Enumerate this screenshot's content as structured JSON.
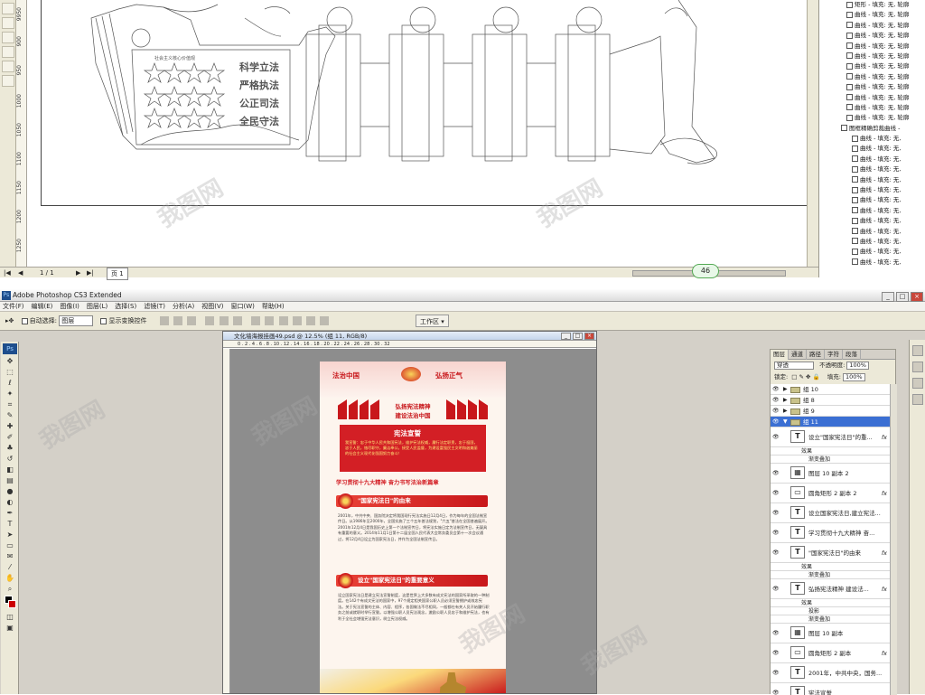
{
  "corel": {
    "vruler_labels": [
      "9950",
      "900",
      "950",
      "1000",
      "1050",
      "1100",
      "1150",
      "1200",
      "1250"
    ],
    "panel_rows": [
      {
        "icon": "rect",
        "text": "矩形 - 填充: 无, 轮廓"
      },
      {
        "icon": "curve",
        "text": "曲线 - 填充: 无, 轮廓"
      },
      {
        "icon": "curve",
        "text": "曲线 - 填充: 无, 轮廓"
      },
      {
        "icon": "curve",
        "text": "曲线 - 填充: 无, 轮廓"
      },
      {
        "icon": "curve",
        "text": "曲线 - 填充: 无, 轮廓"
      },
      {
        "icon": "curve",
        "text": "曲线 - 填充: 无, 轮廓"
      },
      {
        "icon": "curve",
        "text": "曲线 - 填充: 无, 轮廓"
      },
      {
        "icon": "curve",
        "text": "曲线 - 填充: 无, 轮廓"
      },
      {
        "icon": "curve",
        "text": "曲线 - 填充: 无, 轮廓"
      },
      {
        "icon": "curve",
        "text": "曲线 - 填充: 无, 轮廓"
      },
      {
        "icon": "curve",
        "text": "曲线 - 填充: 无, 轮廓"
      },
      {
        "icon": "curve",
        "text": "曲线 - 填充: 无, 轮廓"
      },
      {
        "icon": "group",
        "text": "图框精确剪裁曲线 - "
      },
      {
        "icon": "curve",
        "text": "曲线 - 填充: 无,"
      },
      {
        "icon": "curve",
        "text": "曲线 - 填充: 无,"
      },
      {
        "icon": "curve",
        "text": "曲线 - 填充: 无,"
      },
      {
        "icon": "curve",
        "text": "曲线 - 填充: 无,"
      },
      {
        "icon": "curve",
        "text": "曲线 - 填充: 无,"
      },
      {
        "icon": "curve",
        "text": "曲线 - 填充: 无,"
      },
      {
        "icon": "curve",
        "text": "曲线 - 填充: 无,"
      },
      {
        "icon": "curve",
        "text": "曲线 - 填充: 无,"
      },
      {
        "icon": "curve",
        "text": "曲线 - 填充: 无,"
      },
      {
        "icon": "curve",
        "text": "曲线 - 填充: 无,"
      },
      {
        "icon": "curve",
        "text": "曲线 - 填充: 无,"
      },
      {
        "icon": "curve",
        "text": "曲线 - 填充: 无,"
      },
      {
        "icon": "curve",
        "text": "曲线 - 填充: 无,"
      }
    ],
    "design_texts": {
      "slogan1": "科学立法",
      "slogan2": "严格执法",
      "slogan3": "公正司法",
      "slogan4": "全民守法",
      "header": "社会主义核心价值观"
    },
    "status": {
      "page_info": "1 / 1",
      "page_tab": "页 1",
      "zoom": "46"
    }
  },
  "ps": {
    "app_title": "Adobe Photoshop CS3 Extended",
    "menu": [
      "文件(F)",
      "编辑(E)",
      "图像(I)",
      "图层(L)",
      "选择(S)",
      "滤镜(T)",
      "分析(A)",
      "视图(V)",
      "窗口(W)",
      "帮助(H)"
    ],
    "options": {
      "auto_select_label": "自动选择:",
      "auto_select_value": "图层",
      "show_transform": "显示变换控件",
      "workspace": "工作区"
    },
    "doc": {
      "title": "文化墙海报挂画49.psd @ 12.5% (组 11, RGB/8)",
      "ruler": "0 . 2 . 4 . 6 . 8 . 10 . 12 . 14 . 16 . 18 . 20 . 22 . 24 . 26 . 28 . 30 . 32"
    },
    "poster": {
      "slogan_left": "法治中国",
      "slogan_right": "弘扬正气",
      "mid_line1": "弘扬宪法精神",
      "mid_line2": "建设法治中国",
      "band_title": "宪法宣誓",
      "band_body": "我宣誓：忠于中华人民共和国宪法，维护宪法权威，履行法定职责，忠于祖国，忠于人民，恪尽职守，廉洁奉公，接受人民监督，为建设富强民主文明和谐美丽的社会主义现代化强国努力奋斗！",
      "motto": "学习贯彻十九大精神  奋力书写法治新篇章",
      "sec1": "\"国家宪法日\"的由来",
      "para1": "2001年，中共中央、国务院决定将我国现行宪法实施日12月4日，作为每年的全国法制宣传日。从1986年至2000年，全国实施了三个五年普法规划，\"六五\"普法在全国普遍展开。2001年12月4日是我国历史上第一个法制宣传日，将宪法实施日定为法制宣传日，无疑具有重要的意义。2014年11月1日第十二届全国人民代表大会常务委员会第十一次会议通过，将12月4日设立为国家宪法日，并作为全国法制宣传日。",
      "sec2": "设立\"国家宪法日\"的重要意义",
      "para2": "设立国家宪法日是建立宪法宣誓制度，这是世界上大多数有成文宪法的国家所采取的一种制度。在142个有成文宪法的国家中，97个规定相关国家公职人员必须宣誓拥护或效忠宪法。关于宪法宣誓的主体、内容、程序，各国做法不尽相同，一般都在有关人员开始履行职务之前或就职时举行宣誓。以增强公职人员宪法观念，激励公职人员忠于和维护宪法，也有利于全社会增强宪法意识，树立宪法权威。"
    },
    "panel_tabs": [
      "图层",
      "通道",
      "路径",
      "字符",
      "段落"
    ],
    "blend_mode": "穿透",
    "opacity_label": "不透明度:",
    "opacity_value": "100%",
    "lock_label": "锁定:",
    "fill_label": "填充:",
    "fill_value": "100%",
    "layers": [
      {
        "type": "group",
        "name": "组 10",
        "selected": false
      },
      {
        "type": "group",
        "name": "组 8",
        "selected": false
      },
      {
        "type": "group",
        "name": "组 9",
        "selected": false
      },
      {
        "type": "group-open",
        "name": "组 11",
        "selected": true
      },
      {
        "type": "text",
        "name": "设立\"国家宪法日\"的重...",
        "fx": true
      },
      {
        "type": "sub",
        "name": "效果"
      },
      {
        "type": "sub2",
        "name": "渐变叠加"
      },
      {
        "type": "image",
        "name": "图层 10 副本 2"
      },
      {
        "type": "shape",
        "name": "圆角矩形 2 副本 2",
        "fx": true
      },
      {
        "type": "text",
        "name": "设立国家宪法日,建立宪法..."
      },
      {
        "type": "text",
        "name": "学习贯彻十九大精神 奋..."
      },
      {
        "type": "text",
        "name": "\"国家宪法日\"的由来",
        "fx": true
      },
      {
        "type": "sub",
        "name": "效果"
      },
      {
        "type": "sub2",
        "name": "渐变叠加"
      },
      {
        "type": "text",
        "name": "弘扬宪法精神 建设法...",
        "fx": true
      },
      {
        "type": "sub",
        "name": "效果"
      },
      {
        "type": "sub2",
        "name": "投影"
      },
      {
        "type": "sub2",
        "name": "渐变叠加"
      },
      {
        "type": "image",
        "name": "图层 10 副本"
      },
      {
        "type": "shape",
        "name": "圆角矩形 2 副本",
        "fx": true
      },
      {
        "type": "text",
        "name": "2001年，中共中央，国务..."
      },
      {
        "type": "text",
        "name": "宪法宣誓"
      }
    ]
  },
  "watermark": "我图网"
}
